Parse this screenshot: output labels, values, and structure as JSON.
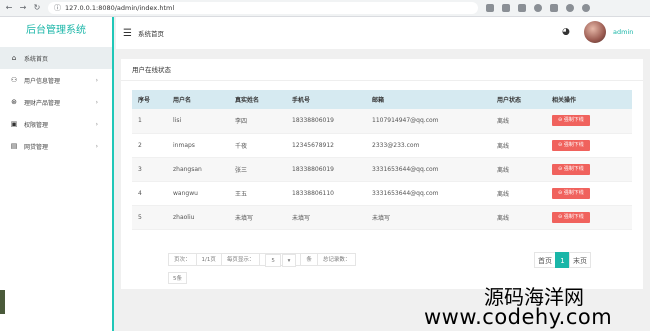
{
  "browser": {
    "url": "127.0.0.1:8080/admin/index.html"
  },
  "sidebar": {
    "brand": "后台管理系统",
    "items": [
      {
        "label": "系统首页",
        "icon": "home-icon",
        "active": true
      },
      {
        "label": "用户信息管理",
        "icon": "users-icon",
        "chevron": true
      },
      {
        "label": "理财产品管理",
        "icon": "money-icon",
        "chevron": true
      },
      {
        "label": "权限管理",
        "icon": "permission-icon",
        "chevron": true
      },
      {
        "label": "网贷管理",
        "icon": "loan-icon",
        "chevron": true
      }
    ]
  },
  "topbar": {
    "title": "系统首页",
    "user": "admin"
  },
  "card": {
    "title": "用户在线状态",
    "columns": [
      "序号",
      "用户名",
      "真实姓名",
      "手机号",
      "邮箱",
      "用户状态",
      "相关操作"
    ],
    "rows": [
      {
        "id": "1",
        "username": "lisi",
        "realname": "李四",
        "phone": "18338806019",
        "email": "1107914947@qq.com",
        "status": "离线",
        "action": "强制下线"
      },
      {
        "id": "2",
        "username": "inmaps",
        "realname": "千夜",
        "phone": "12345678912",
        "email": "2333@233.com",
        "status": "离线",
        "action": "强制下线"
      },
      {
        "id": "3",
        "username": "zhangsan",
        "realname": "张三",
        "phone": "18338806019",
        "email": "3331653644@qq.com",
        "status": "离线",
        "action": "强制下线"
      },
      {
        "id": "4",
        "username": "wangwu",
        "realname": "王五",
        "phone": "18338806110",
        "email": "3331653644@qq.com",
        "status": "离线",
        "action": "强制下线"
      },
      {
        "id": "5",
        "username": "zhaoliu",
        "realname": "未填写",
        "phone": "未填写",
        "email": "未填写",
        "status": "离线",
        "action": "强制下线"
      }
    ],
    "pagination": {
      "page_label": "页次：",
      "page_value": "1/1页",
      "per_page_label": "每页显示：",
      "per_page_value": "5",
      "unit": "条",
      "total_label": "总记录数：",
      "total_value": "5条",
      "first": "首页",
      "current": "1",
      "last": "末页"
    }
  },
  "watermark": {
    "line1": "源码海洋网",
    "line2": "www.codehy.com"
  }
}
